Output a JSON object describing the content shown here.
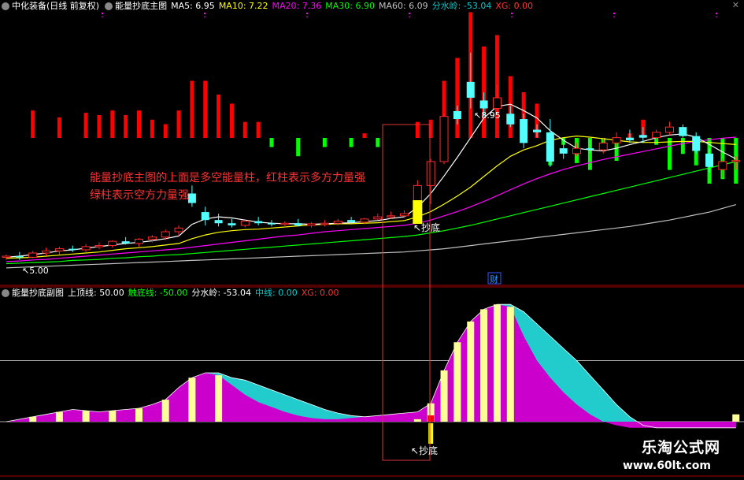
{
  "main_header": {
    "stock": "中化装备(日线 前复权)",
    "indicator": "能量抄底主图",
    "items": [
      {
        "text": "MA5: 6.95",
        "color": "#ffffff"
      },
      {
        "text": "MA10: 7.22",
        "color": "#ffff00"
      },
      {
        "text": "MA20: 7.36",
        "color": "#ff00ff"
      },
      {
        "text": "MA30: 6.90",
        "color": "#00ff00"
      },
      {
        "text": "MA60: 6.09",
        "color": "#c0c0c0"
      },
      {
        "text": "分水岭: -53.04",
        "color": "#00cccc"
      },
      {
        "text": "XG: 0.00",
        "color": "#ff3333"
      }
    ]
  },
  "sub_header": {
    "indicator": "能量抄底副图",
    "items": [
      {
        "text": "上顶线: 50.00",
        "color": "#ffffff"
      },
      {
        "text": "触底线: -50.00",
        "color": "#00ff00"
      },
      {
        "text": "分水岭: -53.04",
        "color": "#ffffff"
      },
      {
        "text": "中线: 0.00",
        "color": "#00cccc"
      },
      {
        "text": "XG: 0.00",
        "color": "#ff3333"
      }
    ]
  },
  "annotations": {
    "main_note_1": "能量抄底主图的上面是多空能量柱，红柱表示多方力量强",
    "main_note_2": "绿柱表示空方力量强",
    "high_price": "8.95",
    "low_price": "5.00",
    "chaodi_main": "抄底",
    "chaodi_sub": "抄底",
    "cai_badge": "财"
  },
  "watermark": {
    "title": "乐淘公式网",
    "url": "www.60lt.com"
  },
  "colors": {
    "up": "#ff2a2a",
    "down": "#54ffff",
    "bull_bar": "#ff0000",
    "bear_bar": "#00ff00",
    "ma5": "#ffffff",
    "ma10": "#ffff00",
    "ma20": "#ff00ff",
    "ma30": "#00ff00",
    "ma60": "#c0c0c0",
    "magenta_fill": "#cc00cc",
    "cyan_fill": "#22cccc",
    "yellow_bar": "#ffff99",
    "note": "#ff3333"
  },
  "chart_data": [
    {
      "type": "candlestick",
      "candles": [
        [
          5.1,
          5.15,
          5.05,
          5.12
        ],
        [
          5.12,
          5.2,
          5.05,
          5.1
        ],
        [
          5.1,
          5.22,
          5.08,
          5.18
        ],
        [
          5.18,
          5.28,
          5.12,
          5.22
        ],
        [
          5.22,
          5.3,
          5.15,
          5.26
        ],
        [
          5.26,
          5.32,
          5.2,
          5.24
        ],
        [
          5.24,
          5.35,
          5.2,
          5.3
        ],
        [
          5.3,
          5.38,
          5.25,
          5.32
        ],
        [
          5.32,
          5.42,
          5.28,
          5.4
        ],
        [
          5.4,
          5.48,
          5.34,
          5.36
        ],
        [
          5.36,
          5.46,
          5.3,
          5.44
        ],
        [
          5.44,
          5.52,
          5.38,
          5.48
        ],
        [
          5.48,
          5.62,
          5.42,
          5.58
        ],
        [
          5.58,
          5.7,
          5.5,
          5.65
        ],
        [
          6.3,
          6.45,
          6.05,
          6.12
        ],
        [
          5.95,
          6.05,
          5.7,
          5.8
        ],
        [
          5.8,
          5.92,
          5.68,
          5.74
        ],
        [
          5.74,
          5.82,
          5.66,
          5.7
        ],
        [
          5.7,
          5.82,
          5.66,
          5.78
        ],
        [
          5.78,
          5.86,
          5.7,
          5.74
        ],
        [
          5.74,
          5.8,
          5.68,
          5.72
        ],
        [
          5.72,
          5.78,
          5.66,
          5.74
        ],
        [
          5.74,
          5.82,
          5.68,
          5.7
        ],
        [
          5.7,
          5.76,
          5.66,
          5.73
        ],
        [
          5.73,
          5.8,
          5.68,
          5.74
        ],
        [
          5.74,
          5.82,
          5.7,
          5.78
        ],
        [
          5.8,
          5.86,
          5.74,
          5.76
        ],
        [
          5.76,
          5.84,
          5.72,
          5.82
        ],
        [
          5.82,
          5.92,
          5.8,
          5.86
        ],
        [
          5.86,
          5.96,
          5.82,
          5.88
        ],
        [
          5.88,
          5.98,
          5.84,
          5.92
        ],
        [
          5.92,
          6.55,
          5.9,
          6.45
        ],
        [
          6.45,
          6.95,
          6.1,
          6.9
        ],
        [
          6.9,
          7.8,
          6.85,
          7.75
        ],
        [
          7.85,
          7.95,
          7.6,
          7.7
        ],
        [
          8.4,
          8.95,
          7.9,
          8.1
        ],
        [
          8.05,
          8.2,
          7.75,
          7.9
        ],
        [
          7.9,
          8.35,
          7.8,
          8.1
        ],
        [
          7.8,
          7.95,
          7.55,
          7.6
        ],
        [
          7.7,
          7.8,
          7.15,
          7.25
        ],
        [
          7.5,
          7.6,
          7.35,
          7.45
        ],
        [
          7.45,
          7.7,
          6.8,
          6.9
        ],
        [
          7.15,
          7.3,
          6.95,
          7.05
        ],
        [
          7.05,
          7.25,
          7.0,
          7.15
        ],
        [
          7.15,
          7.3,
          7.05,
          7.12
        ],
        [
          7.12,
          7.35,
          7.05,
          7.25
        ],
        [
          7.25,
          7.45,
          7.18,
          7.35
        ],
        [
          7.35,
          7.5,
          7.25,
          7.3
        ],
        [
          7.4,
          7.55,
          7.25,
          7.35
        ],
        [
          7.35,
          7.5,
          7.3,
          7.45
        ],
        [
          7.45,
          7.65,
          7.4,
          7.55
        ],
        [
          7.55,
          7.6,
          7.35,
          7.38
        ],
        [
          7.38,
          7.45,
          7.05,
          7.1
        ],
        [
          7.05,
          7.15,
          6.7,
          6.8
        ],
        [
          6.75,
          6.95,
          6.6,
          6.9
        ],
        [
          6.9,
          7.0,
          6.75,
          6.92
        ]
      ],
      "ma5": [
        5.1,
        5.12,
        5.15,
        5.18,
        5.22,
        5.24,
        5.27,
        5.3,
        5.33,
        5.36,
        5.38,
        5.41,
        5.45,
        5.5,
        5.72,
        5.82,
        5.86,
        5.84,
        5.8,
        5.76,
        5.74,
        5.73,
        5.73,
        5.72,
        5.73,
        5.74,
        5.75,
        5.77,
        5.79,
        5.83,
        5.86,
        6.04,
        6.3,
        6.63,
        6.98,
        7.35,
        7.72,
        7.94,
        7.98,
        7.86,
        7.72,
        7.48,
        7.3,
        7.15,
        7.12,
        7.1,
        7.15,
        7.22,
        7.28,
        7.35,
        7.4,
        7.42,
        7.36,
        7.22,
        7.08,
        6.95
      ],
      "ma10": [
        5.08,
        5.09,
        5.1,
        5.12,
        5.14,
        5.16,
        5.18,
        5.2,
        5.23,
        5.26,
        5.28,
        5.3,
        5.33,
        5.36,
        5.45,
        5.52,
        5.57,
        5.6,
        5.62,
        5.63,
        5.65,
        5.67,
        5.69,
        5.71,
        5.72,
        5.73,
        5.73,
        5.74,
        5.75,
        5.77,
        5.79,
        5.86,
        5.96,
        6.1,
        6.25,
        6.42,
        6.62,
        6.82,
        7.0,
        7.12,
        7.2,
        7.3,
        7.35,
        7.38,
        7.36,
        7.33,
        7.3,
        7.27,
        7.26,
        7.26,
        7.27,
        7.28,
        7.28,
        7.26,
        7.24,
        7.22
      ],
      "ma20": [
        5.02,
        5.03,
        5.05,
        5.06,
        5.08,
        5.1,
        5.12,
        5.14,
        5.16,
        5.18,
        5.2,
        5.22,
        5.24,
        5.26,
        5.29,
        5.32,
        5.35,
        5.38,
        5.41,
        5.44,
        5.47,
        5.5,
        5.52,
        5.55,
        5.58,
        5.6,
        5.62,
        5.64,
        5.66,
        5.68,
        5.7,
        5.74,
        5.8,
        5.88,
        5.96,
        6.05,
        6.15,
        6.26,
        6.37,
        6.48,
        6.58,
        6.67,
        6.75,
        6.82,
        6.88,
        6.94,
        6.99,
        7.04,
        7.09,
        7.14,
        7.19,
        7.24,
        7.28,
        7.31,
        7.34,
        7.36
      ],
      "ma30": [
        4.98,
        4.99,
        5.0,
        5.01,
        5.02,
        5.04,
        5.05,
        5.06,
        5.08,
        5.09,
        5.11,
        5.12,
        5.14,
        5.15,
        5.17,
        5.19,
        5.21,
        5.23,
        5.25,
        5.27,
        5.29,
        5.31,
        5.33,
        5.35,
        5.37,
        5.39,
        5.41,
        5.43,
        5.45,
        5.47,
        5.49,
        5.52,
        5.56,
        5.6,
        5.65,
        5.7,
        5.76,
        5.82,
        5.88,
        5.94,
        6.0,
        6.06,
        6.12,
        6.18,
        6.24,
        6.3,
        6.36,
        6.42,
        6.48,
        6.54,
        6.6,
        6.66,
        6.72,
        6.78,
        6.84,
        6.9
      ],
      "ma60": [
        4.9,
        4.91,
        4.92,
        4.93,
        4.94,
        4.95,
        4.96,
        4.97,
        4.98,
        4.99,
        5.0,
        5.01,
        5.02,
        5.03,
        5.04,
        5.05,
        5.06,
        5.07,
        5.08,
        5.09,
        5.1,
        5.11,
        5.12,
        5.13,
        5.14,
        5.15,
        5.16,
        5.17,
        5.18,
        5.19,
        5.2,
        5.22,
        5.24,
        5.26,
        5.29,
        5.32,
        5.35,
        5.38,
        5.41,
        5.44,
        5.47,
        5.5,
        5.53,
        5.56,
        5.59,
        5.62,
        5.65,
        5.68,
        5.72,
        5.76,
        5.8,
        5.85,
        5.9,
        5.95,
        6.02,
        6.09
      ],
      "energy": [
        0,
        0,
        12,
        0,
        9,
        0,
        11,
        10,
        12,
        10,
        12,
        8,
        6,
        12,
        25,
        25,
        19,
        15,
        7,
        7,
        -4,
        0,
        -8,
        0,
        -4,
        0,
        -4,
        2,
        -4,
        0,
        0,
        7,
        8,
        25,
        35,
        55,
        40,
        45,
        27,
        20,
        15,
        -12,
        -3,
        -11,
        -14,
        -5,
        -10,
        2,
        8,
        -3,
        -14,
        -7,
        -12,
        -20,
        -18,
        -20
      ]
    },
    {
      "type": "area",
      "top_line": 50,
      "bottom_line": -50,
      "mid_line": 0,
      "magenta": [
        0,
        2,
        4,
        6,
        8,
        10,
        9,
        8,
        9,
        10,
        11,
        14,
        18,
        28,
        36,
        40,
        38,
        30,
        22,
        16,
        12,
        8,
        5,
        3,
        2,
        2,
        3,
        4,
        5,
        6,
        7,
        8,
        15,
        42,
        65,
        82,
        92,
        96,
        94,
        70,
        50,
        36,
        24,
        14,
        6,
        0,
        -3,
        -5,
        -5,
        -5,
        -5,
        -5,
        -5,
        -5,
        -5,
        -5
      ],
      "cyan": [
        0,
        2,
        4,
        6,
        8,
        10,
        9,
        8,
        9,
        10,
        11,
        14,
        18,
        28,
        36,
        40,
        40,
        36,
        34,
        30,
        26,
        22,
        18,
        14,
        10,
        7,
        5,
        4,
        5,
        6,
        7,
        8,
        15,
        42,
        65,
        82,
        92,
        96,
        96,
        90,
        80,
        70,
        60,
        50,
        38,
        26,
        14,
        4,
        -3,
        -5,
        -5,
        -5,
        -5,
        -5,
        -5,
        -5
      ],
      "yellow": [
        0,
        2,
        4,
        6,
        8,
        10,
        9,
        8,
        9,
        10,
        11,
        14,
        18,
        28,
        36,
        40,
        38,
        30,
        0,
        0,
        0,
        0,
        0,
        0,
        0,
        0,
        0,
        0,
        0,
        0,
        0,
        2,
        15,
        42,
        65,
        82,
        92,
        96,
        94,
        0,
        0,
        0,
        0,
        0,
        0,
        0,
        0,
        0,
        0,
        0,
        0,
        0,
        0,
        0,
        0,
        6
      ],
      "red_bar_index": 32,
      "yellow_down_index": 32,
      "yellow_down_value": -10
    }
  ]
}
